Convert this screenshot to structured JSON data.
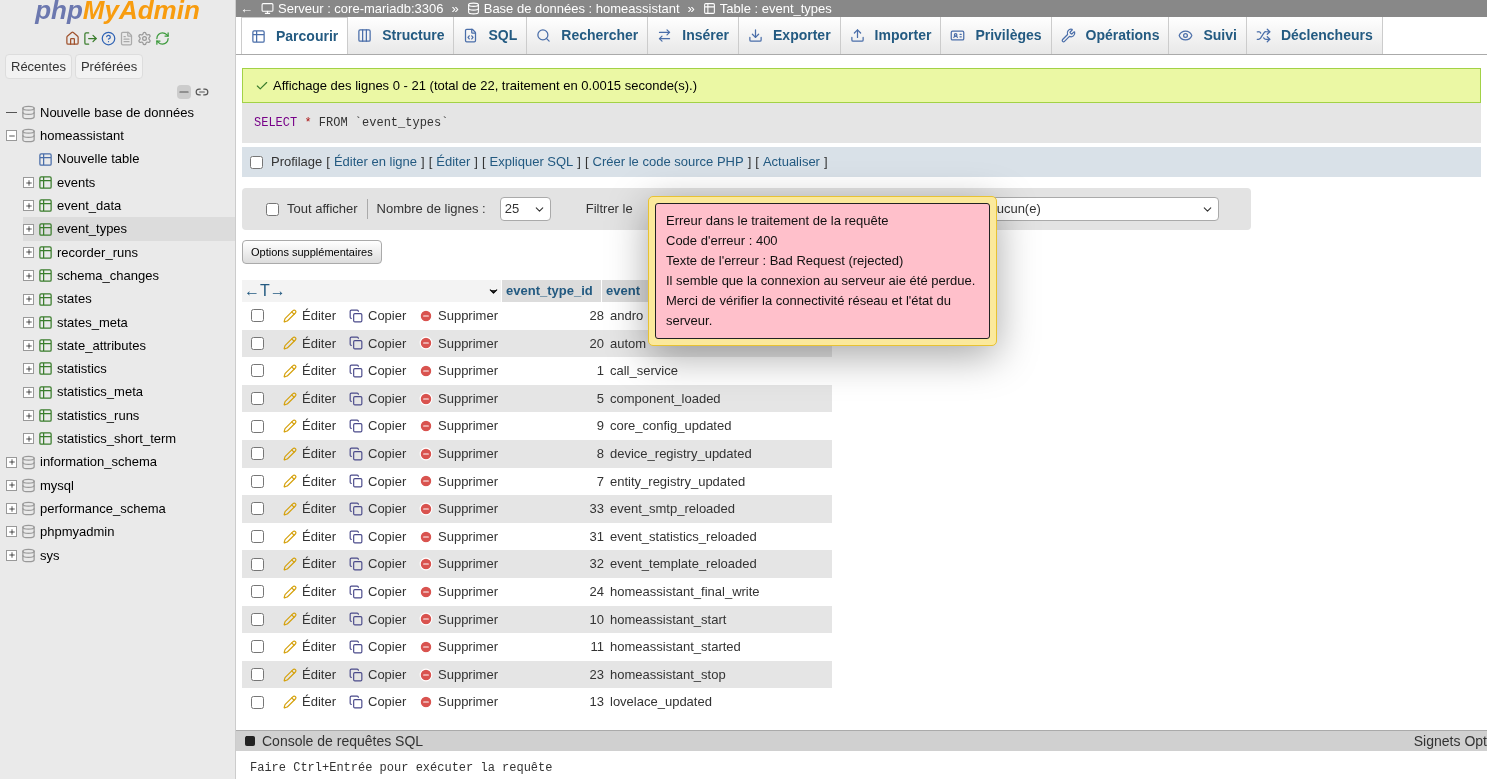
{
  "logo": {
    "part1": "php",
    "part2": "MyAdmin"
  },
  "sidebar_buttons": [
    {
      "label": "Récentes"
    },
    {
      "label": "Préférées"
    }
  ],
  "tree": [
    {
      "label": "Nouvelle base de données",
      "kind": "new"
    },
    {
      "label": "homeassistant",
      "kind": "db",
      "expanded": true,
      "children": [
        {
          "label": "Nouvelle table",
          "kind": "new",
          "selected": false
        },
        {
          "label": "events",
          "kind": "table",
          "selected": false
        },
        {
          "label": "event_data",
          "kind": "table",
          "selected": false
        },
        {
          "label": "event_types",
          "kind": "table",
          "selected": true
        },
        {
          "label": "recorder_runs",
          "kind": "table",
          "selected": false
        },
        {
          "label": "schema_changes",
          "kind": "table",
          "selected": false
        },
        {
          "label": "states",
          "kind": "table",
          "selected": false
        },
        {
          "label": "states_meta",
          "kind": "table",
          "selected": false
        },
        {
          "label": "state_attributes",
          "kind": "table",
          "selected": false
        },
        {
          "label": "statistics",
          "kind": "table",
          "selected": false
        },
        {
          "label": "statistics_meta",
          "kind": "table",
          "selected": false
        },
        {
          "label": "statistics_runs",
          "kind": "table",
          "selected": false
        },
        {
          "label": "statistics_short_term",
          "kind": "table",
          "selected": false
        }
      ]
    },
    {
      "label": "information_schema",
      "kind": "db",
      "expanded": false
    },
    {
      "label": "mysql",
      "kind": "db",
      "expanded": false
    },
    {
      "label": "performance_schema",
      "kind": "db",
      "expanded": false
    },
    {
      "label": "phpmyadmin",
      "kind": "db",
      "expanded": false
    },
    {
      "label": "sys",
      "kind": "db",
      "expanded": false
    }
  ],
  "back_arrow": "←",
  "breadcrumb": [
    {
      "kind": "server",
      "text": "Serveur : core-mariadb:3306"
    },
    {
      "kind": "db",
      "text": "Base de données : homeassistant"
    },
    {
      "kind": "table",
      "text": "Table : event_types"
    }
  ],
  "breadcrumb_separator": "»",
  "tabs": [
    {
      "label": "Parcourir",
      "selected": true
    },
    {
      "label": "Structure",
      "selected": false
    },
    {
      "label": "SQL",
      "selected": false
    },
    {
      "label": "Rechercher",
      "selected": false
    },
    {
      "label": "Insérer",
      "selected": false
    },
    {
      "label": "Exporter",
      "selected": false
    },
    {
      "label": "Importer",
      "selected": false
    },
    {
      "label": "Privilèges",
      "selected": false
    },
    {
      "label": "Opérations",
      "selected": false
    },
    {
      "label": "Suivi",
      "selected": false
    },
    {
      "label": "Déclencheurs",
      "selected": false
    }
  ],
  "success_message": "Affichage des lignes 0 - 21 (total de 22, traitement en 0.0015 seconde(s).)",
  "query": {
    "keyword": "SELECT",
    "star": "*",
    "from": "FROM",
    "table": "`event_types`"
  },
  "profiling": {
    "label": "Profilage",
    "checked": false,
    "links": [
      {
        "open": "[",
        "text": "Éditer en ligne",
        "close": "]"
      },
      {
        "open": "[",
        "text": "Éditer",
        "close": "]"
      },
      {
        "open": "[",
        "text": "Expliquer SQL",
        "close": "]"
      },
      {
        "open": "[",
        "text": "Créer le code source PHP",
        "close": "]"
      },
      {
        "open": "[",
        "text": "Actualiser",
        "close": "]"
      }
    ]
  },
  "navigation": {
    "show_all": {
      "label": "Tout afficher",
      "checked": false
    },
    "rows_label": "Nombre de lignes :",
    "rows_value": "25",
    "filter_label": "Filtrer le",
    "sort_value": "ucun(e)"
  },
  "extra_options_button": "Options supplémentaires",
  "table": {
    "arrows": "←T→",
    "columns": [
      "event_type_id",
      "event"
    ],
    "rows": [
      {
        "id": "28",
        "name": "andro",
        "checked": false,
        "actions": [
          "Éditer",
          "Copier",
          "Supprimer"
        ]
      },
      {
        "id": "20",
        "name": "autom",
        "checked": false,
        "actions": [
          "Éditer",
          "Copier",
          "Supprimer"
        ]
      },
      {
        "id": "1",
        "name": "call_service",
        "checked": false,
        "actions": [
          "Éditer",
          "Copier",
          "Supprimer"
        ]
      },
      {
        "id": "5",
        "name": "component_loaded",
        "checked": false,
        "actions": [
          "Éditer",
          "Copier",
          "Supprimer"
        ]
      },
      {
        "id": "9",
        "name": "core_config_updated",
        "checked": false,
        "actions": [
          "Éditer",
          "Copier",
          "Supprimer"
        ]
      },
      {
        "id": "8",
        "name": "device_registry_updated",
        "checked": false,
        "actions": [
          "Éditer",
          "Copier",
          "Supprimer"
        ]
      },
      {
        "id": "7",
        "name": "entity_registry_updated",
        "checked": false,
        "actions": [
          "Éditer",
          "Copier",
          "Supprimer"
        ]
      },
      {
        "id": "33",
        "name": "event_smtp_reloaded",
        "checked": false,
        "actions": [
          "Éditer",
          "Copier",
          "Supprimer"
        ]
      },
      {
        "id": "31",
        "name": "event_statistics_reloaded",
        "checked": false,
        "actions": [
          "Éditer",
          "Copier",
          "Supprimer"
        ]
      },
      {
        "id": "32",
        "name": "event_template_reloaded",
        "checked": false,
        "actions": [
          "Éditer",
          "Copier",
          "Supprimer"
        ]
      },
      {
        "id": "24",
        "name": "homeassistant_final_write",
        "checked": false,
        "actions": [
          "Éditer",
          "Copier",
          "Supprimer"
        ]
      },
      {
        "id": "10",
        "name": "homeassistant_start",
        "checked": false,
        "actions": [
          "Éditer",
          "Copier",
          "Supprimer"
        ]
      },
      {
        "id": "11",
        "name": "homeassistant_started",
        "checked": false,
        "actions": [
          "Éditer",
          "Copier",
          "Supprimer"
        ]
      },
      {
        "id": "23",
        "name": "homeassistant_stop",
        "checked": false,
        "actions": [
          "Éditer",
          "Copier",
          "Supprimer"
        ]
      },
      {
        "id": "13",
        "name": "lovelace_updated",
        "checked": false,
        "actions": [
          "Éditer",
          "Copier",
          "Supprimer"
        ]
      }
    ]
  },
  "error_popup": [
    "Erreur dans le traitement de la requête",
    "Code d'erreur : 400",
    "Texte de l'erreur : Bad Request (rejected)",
    "Il semble que la connexion au serveur aie été perdue.",
    "Merci de vérifier la connectivité réseau et l'état du serveur."
  ],
  "console": {
    "title": "Console de requêtes SQL",
    "links": [
      "Signets",
      "Opt"
    ],
    "hint": "Faire Ctrl+Entrée pour exécuter la requête"
  }
}
